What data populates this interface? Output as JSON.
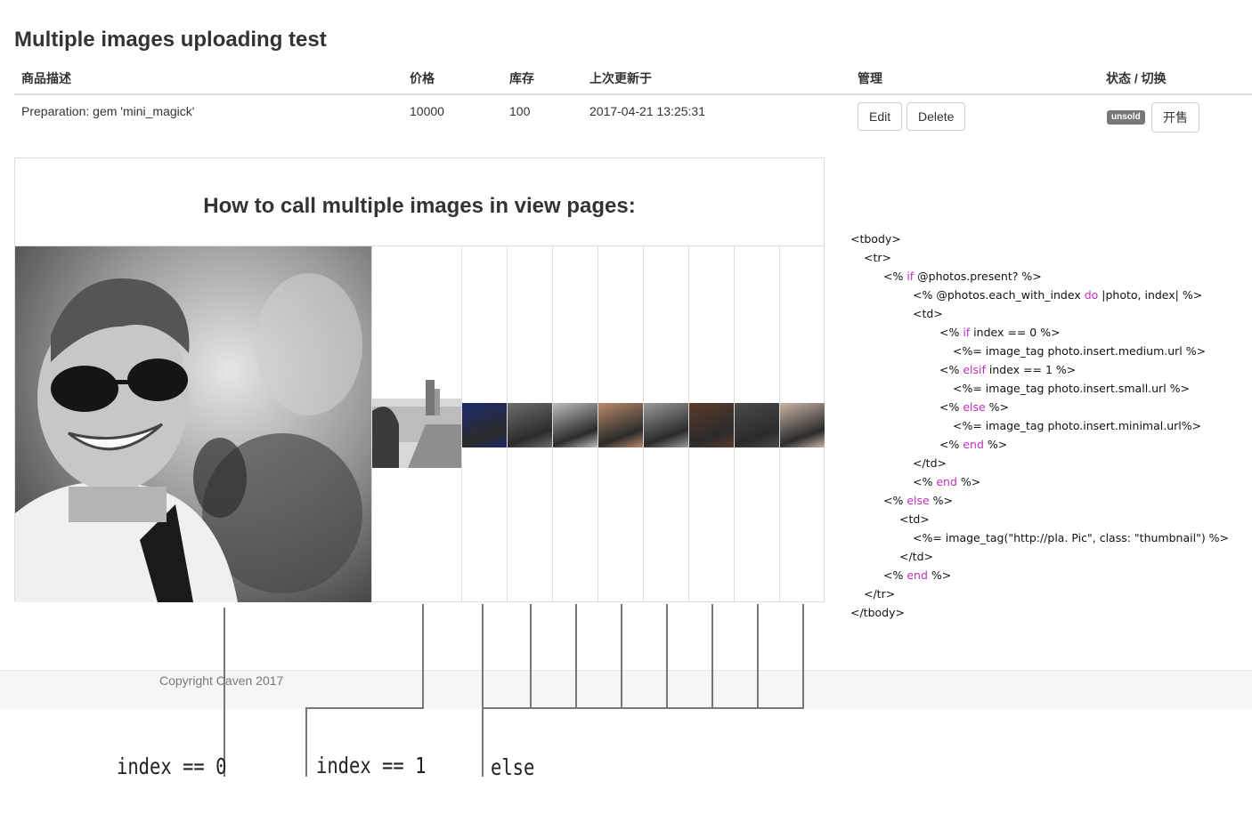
{
  "page": {
    "title": "Multiple images uploading test"
  },
  "table": {
    "headers": [
      "商品描述",
      "价格",
      "库存",
      "上次更新于",
      "管理",
      "状态 / 切换"
    ],
    "row": {
      "description": "Preparation: gem 'mini_magick'",
      "price": "10000",
      "stock": "100",
      "updated_at": "2017-04-21 13:25:31",
      "edit_label": "Edit",
      "delete_label": "Delete",
      "status_badge": "unsold",
      "toggle_label": "开售"
    }
  },
  "panel": {
    "heading": "How to call multiple images in view pages:"
  },
  "thumbnails": [
    {
      "name": "thumbnail-city-street",
      "tone": "#8a8a8a"
    },
    {
      "name": "thumbnail-night-storefront",
      "tone": "#1b2a6b"
    },
    {
      "name": "thumbnail-bw-street",
      "tone": "#6d6d6d"
    },
    {
      "name": "thumbnail-bw-snow-tree",
      "tone": "#bdbdbd"
    },
    {
      "name": "thumbnail-cake",
      "tone": "#b98a6a"
    },
    {
      "name": "thumbnail-bedroom",
      "tone": "#9a9a9a"
    },
    {
      "name": "thumbnail-portrait-man",
      "tone": "#5b3a2a"
    },
    {
      "name": "thumbnail-bw-crowd",
      "tone": "#4a4a4a"
    },
    {
      "name": "thumbnail-portrait-woman",
      "tone": "#c9b4a6"
    }
  ],
  "code": {
    "lines": [
      {
        "indent": 0,
        "parts": [
          {
            "t": "<tbody>"
          }
        ]
      },
      {
        "indent": 15,
        "parts": [
          {
            "t": "<tr>"
          }
        ]
      },
      {
        "indent": 37,
        "parts": [
          {
            "t": "<% "
          },
          {
            "t": "if",
            "kw": true
          },
          {
            "t": " @photos.present? %>"
          }
        ]
      },
      {
        "indent": 70,
        "parts": [
          {
            "t": "<% @photos.each_with_index "
          },
          {
            "t": "do",
            "kw": true
          },
          {
            "t": " |photo, index| %>"
          }
        ]
      },
      {
        "indent": 70,
        "parts": [
          {
            "t": "<td>"
          }
        ]
      },
      {
        "indent": 100,
        "parts": [
          {
            "t": "<% "
          },
          {
            "t": "if",
            "kw": true
          },
          {
            "t": " index == 0 %>"
          }
        ]
      },
      {
        "indent": 115,
        "parts": [
          {
            "t": "<%= image_tag photo.insert.medium.url %>"
          }
        ]
      },
      {
        "indent": 100,
        "parts": [
          {
            "t": "<% "
          },
          {
            "t": "elsif",
            "kw": true
          },
          {
            "t": " index == 1 %>"
          }
        ]
      },
      {
        "indent": 115,
        "parts": [
          {
            "t": "<%= image_tag photo.insert.small.url %>"
          }
        ]
      },
      {
        "indent": 100,
        "parts": [
          {
            "t": "<% "
          },
          {
            "t": "else",
            "kw": true
          },
          {
            "t": " %>"
          }
        ]
      },
      {
        "indent": 115,
        "parts": [
          {
            "t": "<%= image_tag photo.insert.minimal.url%>"
          }
        ]
      },
      {
        "indent": 100,
        "parts": [
          {
            "t": "<% "
          },
          {
            "t": "end",
            "kw": true
          },
          {
            "t": " %>"
          }
        ]
      },
      {
        "indent": 70,
        "parts": [
          {
            "t": "</td>"
          }
        ]
      },
      {
        "indent": 70,
        "parts": [
          {
            "t": "<% "
          },
          {
            "t": "end",
            "kw": true
          },
          {
            "t": " %>"
          }
        ]
      },
      {
        "indent": 37,
        "parts": [
          {
            "t": "<% "
          },
          {
            "t": "else",
            "kw": true
          },
          {
            "t": " %>"
          }
        ]
      },
      {
        "indent": 55,
        "parts": [
          {
            "t": "<td>"
          }
        ]
      },
      {
        "indent": 70,
        "parts": [
          {
            "t": "<%= image_tag(\"http://pla. Pic\", class: \"thumbnail\") %>"
          }
        ]
      },
      {
        "indent": 55,
        "parts": [
          {
            "t": "</td>"
          }
        ]
      },
      {
        "indent": 37,
        "parts": [
          {
            "t": "<% "
          },
          {
            "t": "end",
            "kw": true
          },
          {
            "t": " %>"
          }
        ]
      },
      {
        "indent": 15,
        "parts": [
          {
            "t": "</tr>"
          }
        ]
      },
      {
        "indent": 0,
        "parts": [
          {
            "t": "</tbody>"
          }
        ]
      }
    ]
  },
  "footer": {
    "copyright": "Copyright Caven 2017"
  },
  "annotations": {
    "index0": "index == 0",
    "index1": "index == 1",
    "else": "else"
  }
}
